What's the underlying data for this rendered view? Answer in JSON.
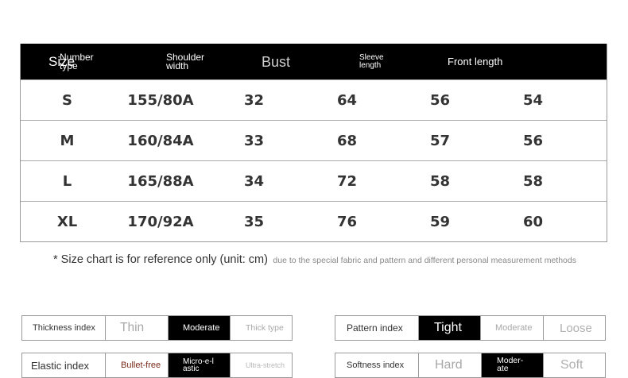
{
  "size_table": {
    "headers": [
      "Size",
      "Number type",
      "Shoulder width",
      "Bust",
      "Sleeve length",
      "Front length"
    ],
    "rows": [
      [
        "S",
        "155/80A",
        "32",
        "64",
        "56",
        "54"
      ],
      [
        "M",
        "160/84A",
        "33",
        "68",
        "57",
        "56"
      ],
      [
        "L",
        "165/88A",
        "34",
        "72",
        "58",
        "58"
      ],
      [
        "XL",
        "170/92A",
        "35",
        "76",
        "59",
        "60"
      ]
    ]
  },
  "note": {
    "main": "* Size chart is for reference only (unit: cm)",
    "sub": "due to the special fabric and pattern and different personal measurement methods"
  },
  "indices": {
    "thickness": {
      "label": "Thickness index",
      "options": [
        "Thin",
        "Moderate",
        "Thick type"
      ],
      "selected": "Moderate"
    },
    "pattern": {
      "label": "Pattern index",
      "options": [
        "Tight",
        "Moderate",
        "Loose"
      ],
      "selected": "Tight"
    },
    "elastic": {
      "label": "Elastic index",
      "options": [
        "Bullet-free",
        "Micro-e-lastic",
        "Ultra-stretch"
      ],
      "selected": "Micro-e-lastic"
    },
    "softness": {
      "label": "Softness index",
      "options": [
        "Hard",
        "Moder-ate",
        "Soft"
      ],
      "selected": "Moder-ate"
    }
  },
  "colors": {
    "header_bg": "#000000",
    "active_bg": "#000000",
    "border": "#9a9a9a",
    "text": "#333333"
  }
}
